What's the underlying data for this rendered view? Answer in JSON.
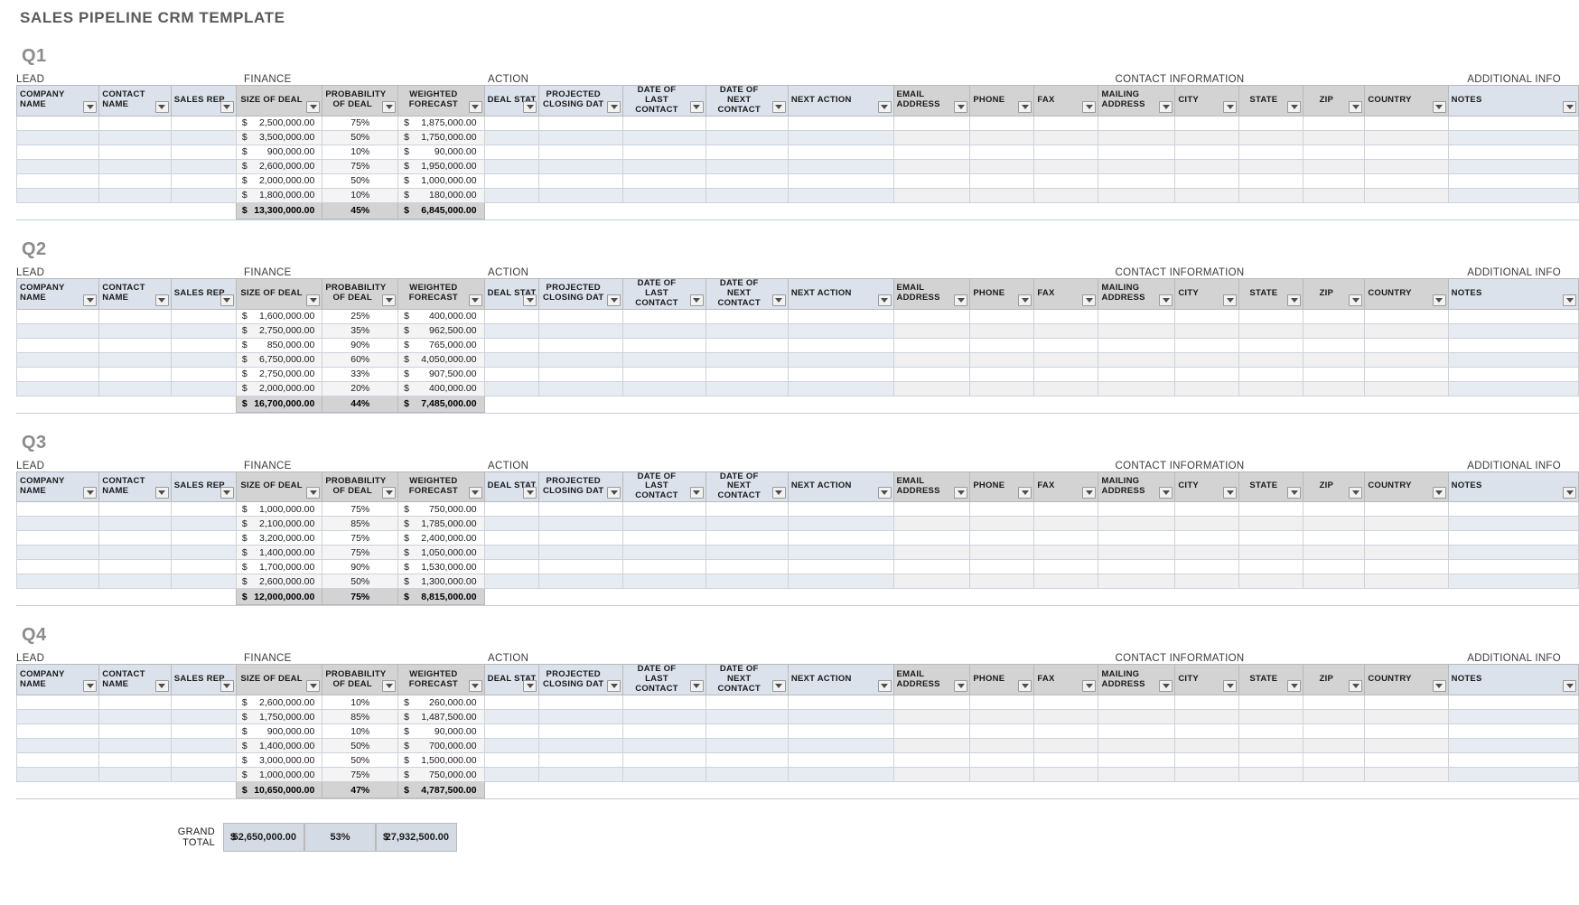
{
  "document": {
    "title": "SALES PIPELINE CRM TEMPLATE"
  },
  "group_bands": {
    "lead": "LEAD",
    "finance": "FINANCE",
    "action": "ACTION",
    "contact_information": "CONTACT INFORMATION",
    "additional_info": "ADDITIONAL INFO"
  },
  "columns": [
    {
      "key": "company_name",
      "label": "COMPANY NAME",
      "group": "lead",
      "tone": "blue",
      "align": "left",
      "type": "text"
    },
    {
      "key": "contact_name",
      "label": "CONTACT NAME",
      "group": "lead",
      "tone": "blue",
      "align": "left",
      "type": "text"
    },
    {
      "key": "sales_rep",
      "label": "SALES REP",
      "group": "lead",
      "tone": "blue",
      "align": "left",
      "type": "text"
    },
    {
      "key": "size_of_deal",
      "label": "SIZE OF DEAL",
      "group": "finance",
      "tone": "gray",
      "align": "center",
      "type": "money"
    },
    {
      "key": "probability",
      "label": "PROBABILITY OF DEAL",
      "group": "finance",
      "tone": "gray",
      "align": "center",
      "type": "percent"
    },
    {
      "key": "weighted",
      "label": "WEIGHTED FORECAST",
      "group": "finance",
      "tone": "gray",
      "align": "center",
      "type": "money"
    },
    {
      "key": "deal_status",
      "label": "DEAL STATUS",
      "group": "action",
      "tone": "blue",
      "align": "center",
      "type": "text"
    },
    {
      "key": "closing_date",
      "label": "PROJECTED CLOSING DAT",
      "group": "action",
      "tone": "blue",
      "align": "center",
      "type": "text"
    },
    {
      "key": "last_contact",
      "label": "DATE OF LAST CONTACT",
      "group": "action",
      "tone": "blue",
      "align": "center",
      "type": "text"
    },
    {
      "key": "next_contact",
      "label": "DATE OF NEXT CONTACT",
      "group": "action",
      "tone": "blue",
      "align": "center",
      "type": "text"
    },
    {
      "key": "next_action",
      "label": "NEXT ACTION",
      "group": "action",
      "tone": "blue",
      "align": "left",
      "type": "text"
    },
    {
      "key": "email",
      "label": "EMAIL ADDRESS",
      "group": "contact",
      "tone": "gray",
      "align": "left",
      "type": "text"
    },
    {
      "key": "phone",
      "label": "PHONE",
      "group": "contact",
      "tone": "gray",
      "align": "left",
      "type": "text"
    },
    {
      "key": "fax",
      "label": "FAX",
      "group": "contact",
      "tone": "gray",
      "align": "left",
      "type": "text"
    },
    {
      "key": "mailing",
      "label": "MAILING ADDRESS",
      "group": "contact",
      "tone": "gray",
      "align": "left",
      "type": "text"
    },
    {
      "key": "city",
      "label": "CITY",
      "group": "contact",
      "tone": "gray",
      "align": "left",
      "type": "text"
    },
    {
      "key": "state",
      "label": "STATE",
      "group": "contact",
      "tone": "gray",
      "align": "center",
      "type": "text"
    },
    {
      "key": "zip",
      "label": "ZIP",
      "group": "contact",
      "tone": "gray",
      "align": "center",
      "type": "text"
    },
    {
      "key": "country",
      "label": "COUNTRY",
      "group": "contact",
      "tone": "gray",
      "align": "left",
      "type": "text"
    },
    {
      "key": "notes",
      "label": "NOTES",
      "group": "addl",
      "tone": "blue",
      "align": "left",
      "type": "text"
    }
  ],
  "filter_icon": "filter-dropdown-icon",
  "currency_symbol": "$",
  "quarters": [
    {
      "label": "Q1",
      "rows": [
        {
          "company_name": "",
          "contact_name": "",
          "sales_rep": "",
          "size_of_deal": "2,500,000.00",
          "probability": "75%",
          "weighted": "1,875,000.00"
        },
        {
          "company_name": "",
          "contact_name": "",
          "sales_rep": "",
          "size_of_deal": "3,500,000.00",
          "probability": "50%",
          "weighted": "1,750,000.00"
        },
        {
          "company_name": "",
          "contact_name": "",
          "sales_rep": "",
          "size_of_deal": "900,000.00",
          "probability": "10%",
          "weighted": "90,000.00"
        },
        {
          "company_name": "",
          "contact_name": "",
          "sales_rep": "",
          "size_of_deal": "2,600,000.00",
          "probability": "75%",
          "weighted": "1,950,000.00"
        },
        {
          "company_name": "",
          "contact_name": "",
          "sales_rep": "",
          "size_of_deal": "2,000,000.00",
          "probability": "50%",
          "weighted": "1,000,000.00"
        },
        {
          "company_name": "",
          "contact_name": "",
          "sales_rep": "",
          "size_of_deal": "1,800,000.00",
          "probability": "10%",
          "weighted": "180,000.00"
        }
      ],
      "total": {
        "size_of_deal": "13,300,000.00",
        "probability": "45%",
        "weighted": "6,845,000.00"
      }
    },
    {
      "label": "Q2",
      "rows": [
        {
          "company_name": "",
          "contact_name": "",
          "sales_rep": "",
          "size_of_deal": "1,600,000.00",
          "probability": "25%",
          "weighted": "400,000.00"
        },
        {
          "company_name": "",
          "contact_name": "",
          "sales_rep": "",
          "size_of_deal": "2,750,000.00",
          "probability": "35%",
          "weighted": "962,500.00"
        },
        {
          "company_name": "",
          "contact_name": "",
          "sales_rep": "",
          "size_of_deal": "850,000.00",
          "probability": "90%",
          "weighted": "765,000.00"
        },
        {
          "company_name": "",
          "contact_name": "",
          "sales_rep": "",
          "size_of_deal": "6,750,000.00",
          "probability": "60%",
          "weighted": "4,050,000.00"
        },
        {
          "company_name": "",
          "contact_name": "",
          "sales_rep": "",
          "size_of_deal": "2,750,000.00",
          "probability": "33%",
          "weighted": "907,500.00"
        },
        {
          "company_name": "",
          "contact_name": "",
          "sales_rep": "",
          "size_of_deal": "2,000,000.00",
          "probability": "20%",
          "weighted": "400,000.00"
        }
      ],
      "total": {
        "size_of_deal": "16,700,000.00",
        "probability": "44%",
        "weighted": "7,485,000.00"
      }
    },
    {
      "label": "Q3",
      "rows": [
        {
          "company_name": "",
          "contact_name": "",
          "sales_rep": "",
          "size_of_deal": "1,000,000.00",
          "probability": "75%",
          "weighted": "750,000.00"
        },
        {
          "company_name": "",
          "contact_name": "",
          "sales_rep": "",
          "size_of_deal": "2,100,000.00",
          "probability": "85%",
          "weighted": "1,785,000.00"
        },
        {
          "company_name": "",
          "contact_name": "",
          "sales_rep": "",
          "size_of_deal": "3,200,000.00",
          "probability": "75%",
          "weighted": "2,400,000.00"
        },
        {
          "company_name": "",
          "contact_name": "",
          "sales_rep": "",
          "size_of_deal": "1,400,000.00",
          "probability": "75%",
          "weighted": "1,050,000.00"
        },
        {
          "company_name": "",
          "contact_name": "",
          "sales_rep": "",
          "size_of_deal": "1,700,000.00",
          "probability": "90%",
          "weighted": "1,530,000.00"
        },
        {
          "company_name": "",
          "contact_name": "",
          "sales_rep": "",
          "size_of_deal": "2,600,000.00",
          "probability": "50%",
          "weighted": "1,300,000.00"
        }
      ],
      "total": {
        "size_of_deal": "12,000,000.00",
        "probability": "75%",
        "weighted": "8,815,000.00"
      }
    },
    {
      "label": "Q4",
      "rows": [
        {
          "company_name": "",
          "contact_name": "",
          "sales_rep": "",
          "size_of_deal": "2,600,000.00",
          "probability": "10%",
          "weighted": "260,000.00"
        },
        {
          "company_name": "",
          "contact_name": "",
          "sales_rep": "",
          "size_of_deal": "1,750,000.00",
          "probability": "85%",
          "weighted": "1,487,500.00"
        },
        {
          "company_name": "",
          "contact_name": "",
          "sales_rep": "",
          "size_of_deal": "900,000.00",
          "probability": "10%",
          "weighted": "90,000.00"
        },
        {
          "company_name": "",
          "contact_name": "",
          "sales_rep": "",
          "size_of_deal": "1,400,000.00",
          "probability": "50%",
          "weighted": "700,000.00"
        },
        {
          "company_name": "",
          "contact_name": "",
          "sales_rep": "",
          "size_of_deal": "3,000,000.00",
          "probability": "50%",
          "weighted": "1,500,000.00"
        },
        {
          "company_name": "",
          "contact_name": "",
          "sales_rep": "",
          "size_of_deal": "1,000,000.00",
          "probability": "75%",
          "weighted": "750,000.00"
        }
      ],
      "total": {
        "size_of_deal": "10,650,000.00",
        "probability": "47%",
        "weighted": "4,787,500.00"
      }
    }
  ],
  "grand_total": {
    "label": "GRAND TOTAL",
    "size_of_deal": "52,650,000.00",
    "probability": "53%",
    "weighted": "27,932,500.00"
  },
  "colors": {
    "header_blue": "#dbe2ec",
    "header_gray": "#d3d3d3",
    "alt_row_blue": "#e7ecf3",
    "alt_row_gray": "#f0f0f0",
    "total_gray": "#d3d3d3",
    "grand_total_blue": "#d5dbe4",
    "title_text": "#5a5a5a",
    "quarter_text": "#8c8c8c"
  }
}
